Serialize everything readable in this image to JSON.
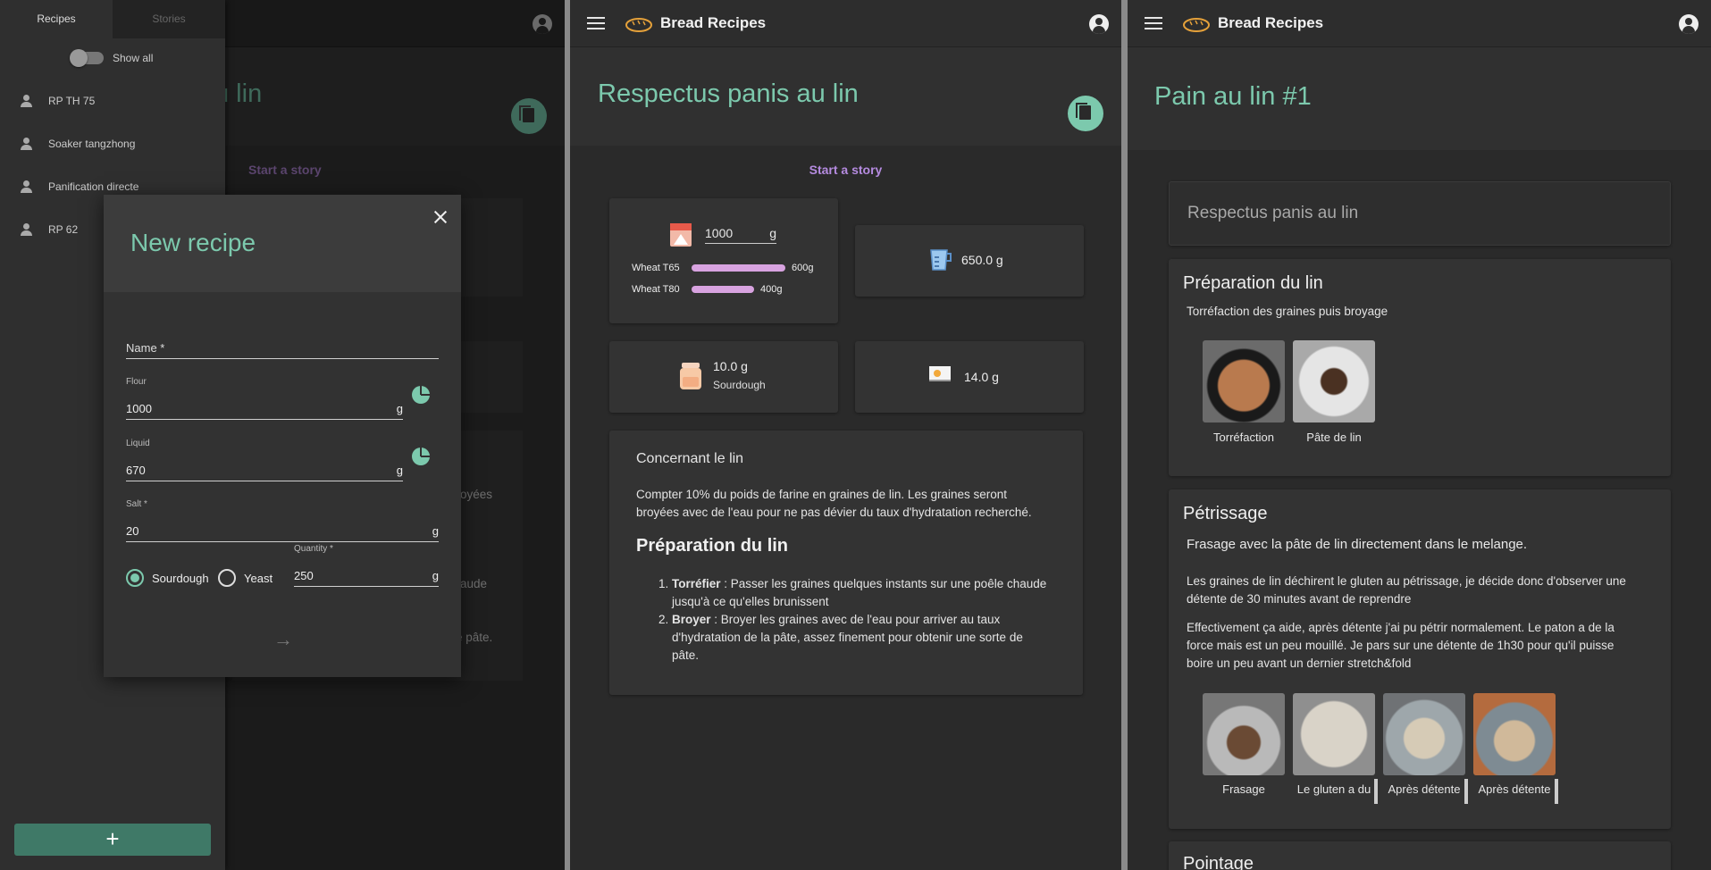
{
  "panel1": {
    "drawer": {
      "tabs": [
        "Recipes",
        "Stories"
      ],
      "toggle_label": "Show all",
      "items": [
        "RP TH 75",
        "Soaker tangzhong",
        "Panification directe",
        "RP 62"
      ],
      "add_label": "+"
    },
    "background": {
      "title_fragment": "u lin",
      "story_link": "Start a story",
      "text_fragments": [
        "oyées",
        "aude",
        "e pâte."
      ]
    },
    "dialog": {
      "title": "New recipe",
      "name_placeholder": "Name *",
      "flour_label": "Flour",
      "flour_value": "1000",
      "flour_unit": "g",
      "liquid_label": "Liquid",
      "liquid_value": "670",
      "liquid_unit": "g",
      "salt_label": "Salt *",
      "salt_value": "20",
      "salt_unit": "g",
      "radio_sourdough": "Sourdough",
      "radio_yeast": "Yeast",
      "selected_leaven": "Sourdough",
      "quantity_label": "Quantity *",
      "quantity_value": "250",
      "quantity_unit": "g",
      "next_arrow": "→"
    }
  },
  "panel2": {
    "app_title": "Bread Recipes",
    "page_title": "Respectus panis au lin",
    "story_link": "Start a story",
    "flour": {
      "total": "1000",
      "unit": "g",
      "rows": [
        {
          "name": "Wheat T65",
          "amount": "600g",
          "fraction": 0.6
        },
        {
          "name": "Wheat T80",
          "amount": "400g",
          "fraction": 0.4
        }
      ]
    },
    "liquid": "650.0 g",
    "leaven": {
      "value": "10.0 g",
      "type": "Sourdough"
    },
    "salt": "14.0 g",
    "notes": {
      "heading": "Concernant le lin",
      "paragraph_line1": "Compter 10% du poids de farine en graines de lin. Les graines seront",
      "paragraph_line2": "broyées avec de l'eau pour ne pas dévier du taux d'hydratation recherché.",
      "section_title": "Préparation du lin",
      "steps": [
        {
          "bold": "Torréfier",
          "line1": " : Passer les graines quelques instants sur une poêle chaude",
          "line2": "jusqu'à ce qu'elles brunissent"
        },
        {
          "bold": "Broyer",
          "line1": " : Broyer les graines avec de l'eau pour arriver au taux",
          "line2": "d'hydratation de la pâte, assez finement pour obtenir une sorte de",
          "line3": "pâte."
        }
      ]
    }
  },
  "panel3": {
    "app_title": "Bread Recipes",
    "page_title": "Pain au lin #1",
    "recipe_ref": "Respectus panis au lin",
    "step1": {
      "title": "Préparation du lin",
      "text": "Torréfaction des graines puis broyage",
      "photos": [
        "Torréfaction",
        "Pâte de lin"
      ]
    },
    "step2": {
      "title": "Pétrissage",
      "text1": "Frasage avec la pâte de lin directement dans le melange.",
      "text2_line1": "Les graines de lin déchirent le gluten au pétrissage, je décide donc d'observer une",
      "text2_line2": "détente de 30 minutes avant de reprendre",
      "text3_line1": "Effectivement ça aide, après détente j'ai pu pétrir normalement. Le paton a de la",
      "text3_line2": "force mais est un peu mouillé. Je pars sur une détente de 1h30 pour qu'il puisse",
      "text3_line3": "boire un peu avant un dernier stretch&fold",
      "photos": [
        "Frasage",
        "Le gluten a du",
        "Après détente",
        "Après détente"
      ]
    },
    "step3_title": "Pointage"
  },
  "colors": {
    "accent": "#7cc9ad",
    "link": "#b58be0",
    "bar": "#d8a3e0",
    "background": "#2a2a2a",
    "card": "#333333"
  }
}
